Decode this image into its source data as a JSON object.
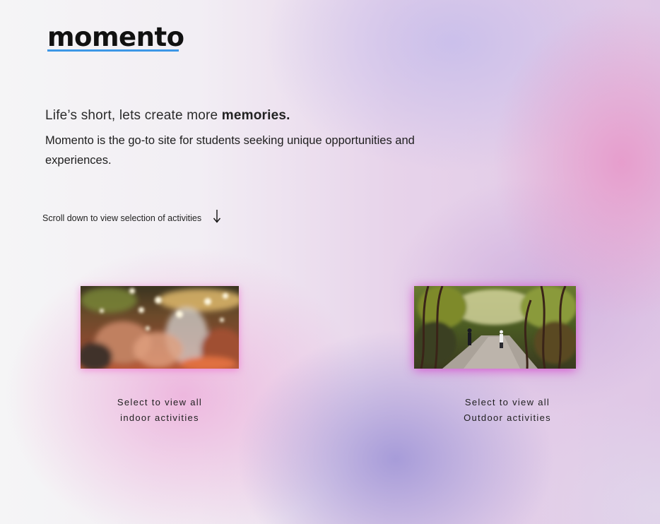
{
  "brand": {
    "logo_text": "momento",
    "underline_color": "#3c97e6"
  },
  "hero": {
    "tagline_prefix": "Life’s short, lets create more ",
    "tagline_bold": "memories.",
    "description": "Momento is the go-to site for students seeking unique opportunities and experiences."
  },
  "scroll_hint": {
    "text": "Scroll down to view selection of activities",
    "icon": "arrow-down-icon"
  },
  "activities": {
    "indoor": {
      "image": "blurred-crowd-bokeh-photo",
      "caption_line1": "Select to view all",
      "caption_line2": "indoor activities"
    },
    "outdoor": {
      "image": "forest-path-photo",
      "caption_line1": "Select to view all",
      "caption_line2": "Outdoor activities"
    }
  }
}
